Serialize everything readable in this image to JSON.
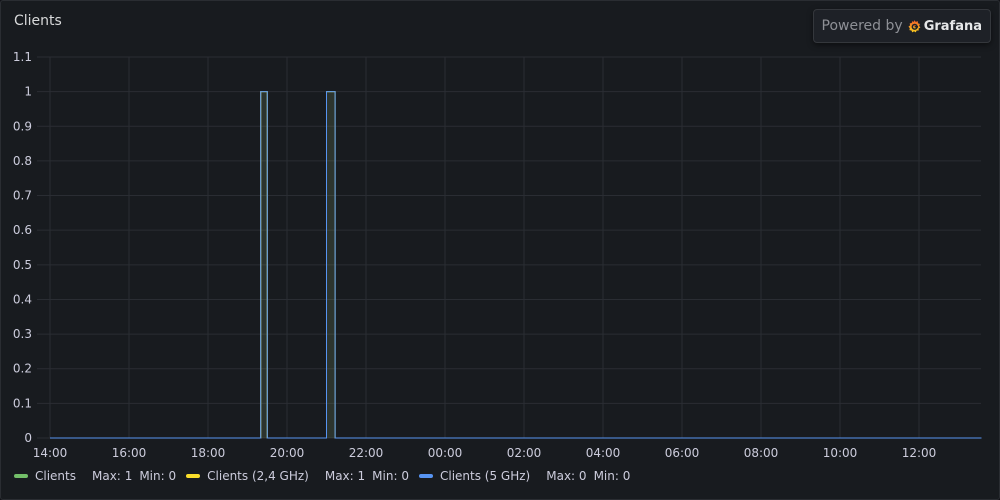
{
  "panel": {
    "title": "Clients",
    "powered_by": "Powered by",
    "brand": "Grafana"
  },
  "chart_data": {
    "type": "line",
    "title": "Clients",
    "x_start": "14:00",
    "x_end": "13:35",
    "x_ticks": [
      "14:00",
      "16:00",
      "18:00",
      "20:00",
      "22:00",
      "00:00",
      "02:00",
      "04:00",
      "06:00",
      "08:00",
      "10:00",
      "12:00"
    ],
    "y_ticks": [
      "0",
      "0.1",
      "0.2",
      "0.3",
      "0.4",
      "0.5",
      "0.6",
      "0.7",
      "0.8",
      "0.9",
      "1",
      "1.1"
    ],
    "ylim": [
      0,
      1.1
    ],
    "grid": true,
    "legend": "bottom",
    "series": [
      {
        "name": "Clients",
        "color": "#73bf69",
        "stats": {
          "max_label": "Max:",
          "max": "1",
          "min_label": "Min:",
          "min": "0"
        },
        "points": [
          [
            "14:00",
            0
          ],
          [
            "19:20",
            0
          ],
          [
            "19:20",
            1
          ],
          [
            "19:30",
            1
          ],
          [
            "19:30",
            0
          ],
          [
            "21:00",
            0
          ],
          [
            "21:00",
            1
          ],
          [
            "21:13",
            1
          ],
          [
            "21:13",
            0
          ],
          [
            "13:35",
            0
          ]
        ]
      },
      {
        "name": "Clients (2,4 GHz)",
        "color": "#fade2a",
        "stats": {
          "max_label": "Max:",
          "max": "1",
          "min_label": "Min:",
          "min": "0"
        },
        "points": [
          [
            "14:00",
            0
          ],
          [
            "19:20",
            0
          ],
          [
            "19:20",
            1
          ],
          [
            "19:30",
            1
          ],
          [
            "19:30",
            0
          ],
          [
            "21:00",
            0
          ],
          [
            "21:00",
            1
          ],
          [
            "21:13",
            1
          ],
          [
            "21:13",
            0
          ],
          [
            "13:35",
            0
          ]
        ]
      },
      {
        "name": "Clients (5 GHz)",
        "color": "#5794f2",
        "stats": {
          "max_label": "Max:",
          "max": "0",
          "min_label": "Min:",
          "min": "0"
        },
        "points": [
          [
            "14:00",
            0
          ],
          [
            "19:20",
            0
          ],
          [
            "19:20",
            1
          ],
          [
            "19:30",
            1
          ],
          [
            "19:30",
            0
          ],
          [
            "21:00",
            0
          ],
          [
            "21:00",
            1
          ],
          [
            "21:13",
            1
          ],
          [
            "21:13",
            0
          ],
          [
            "13:35",
            0
          ]
        ]
      }
    ]
  }
}
